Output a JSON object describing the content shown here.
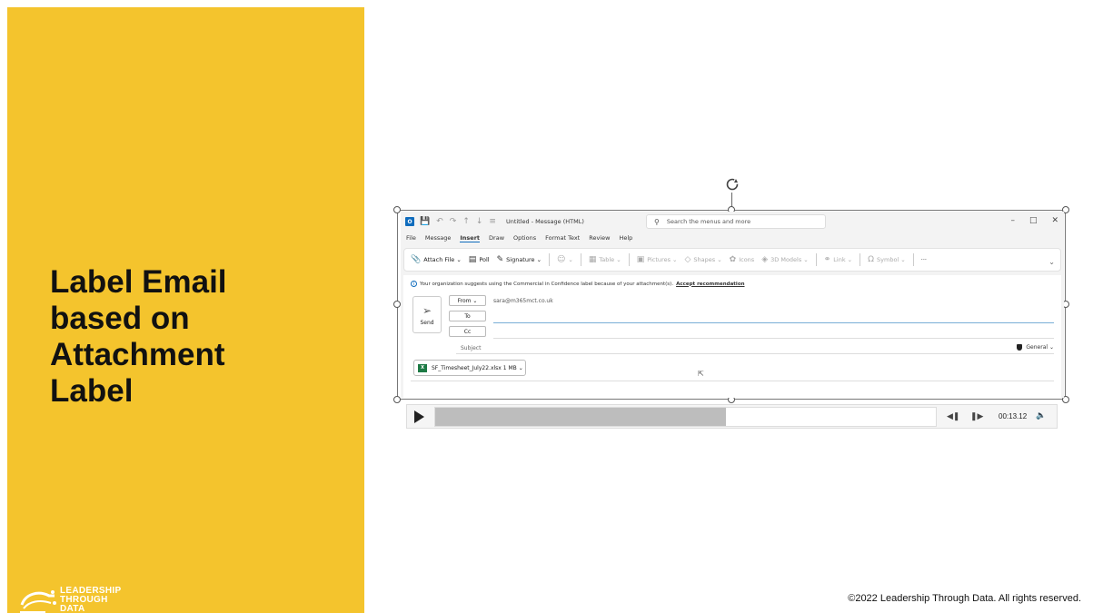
{
  "slide": {
    "title_lines": [
      "Label Email",
      "based on",
      "Attachment",
      "Label"
    ],
    "copyright": "©2022 Leadership Through Data. All rights reserved.",
    "logo_lines": [
      "LEADERSHIP",
      "THROUGH",
      "DATA"
    ]
  },
  "colors": {
    "accent_panel": "#f4c42d",
    "outlook_blue": "#0f6cbd"
  },
  "outlook": {
    "window_title": "Untitled  -  Message (HTML)",
    "search_placeholder": "Search the menus and more",
    "menu": [
      "File",
      "Message",
      "Insert",
      "Draw",
      "Options",
      "Format Text",
      "Review",
      "Help"
    ],
    "active_menu": "Insert",
    "ribbon": {
      "attach_file": "Attach File",
      "poll": "Poll",
      "signature": "Signature",
      "table": "Table",
      "pictures": "Pictures",
      "shapes": "Shapes",
      "icons": "Icons",
      "models": "3D Models",
      "link": "Link",
      "symbol": "Symbol",
      "more": "···"
    },
    "info_text": "Your organization suggests using the Commercial in Confidence label because of your attachment(s).",
    "info_link": "Accept recommendation",
    "send_label": "Send",
    "from_label": "From",
    "from_value": "sara@m365mct.co.uk",
    "to_label": "To",
    "cc_label": "Cc",
    "subject_label": "Subject",
    "sensitivity_label": "General",
    "attachment_name": "SF_Timesheet_July22.xlsx",
    "attachment_size": "1 MB"
  },
  "player": {
    "timecode": "00:13.12",
    "progress": 0.58
  }
}
